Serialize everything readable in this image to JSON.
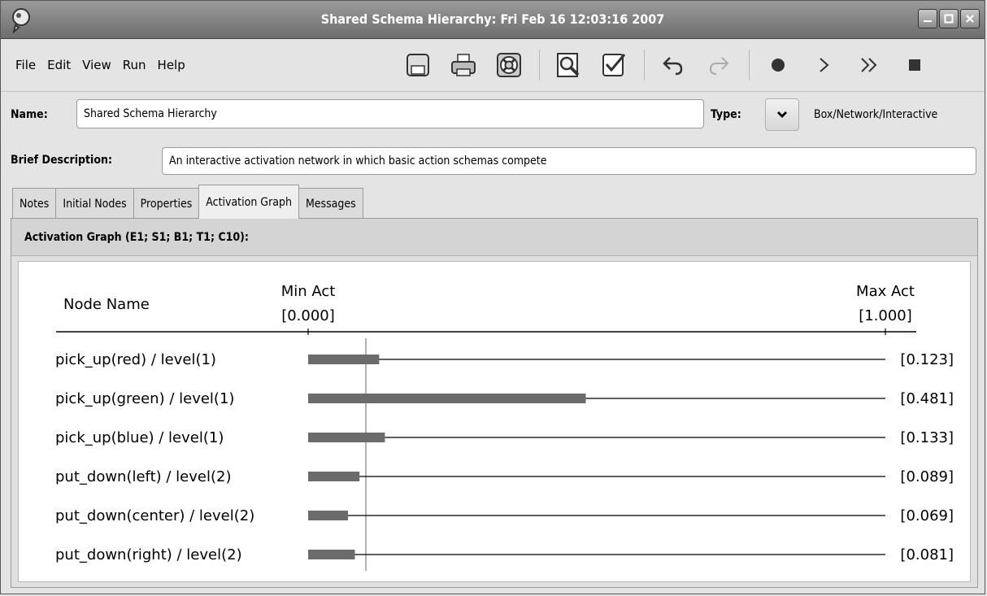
{
  "window": {
    "title": "Shared Schema Hierarchy: Fri Feb 16 12:03:16 2007",
    "controls": [
      "minimize",
      "maximize",
      "close"
    ]
  },
  "menu": {
    "items": [
      "File",
      "Edit",
      "View",
      "Run",
      "Help"
    ]
  },
  "toolbar": {
    "icons": [
      "save-icon",
      "print-icon",
      "lifebuoy-icon",
      "find-icon",
      "validate-icon",
      "undo-icon",
      "redo-icon",
      "record-icon",
      "step-icon",
      "fast-forward-icon",
      "stop-icon"
    ]
  },
  "form": {
    "name_label": "Name:",
    "name_value": "Shared Schema Hierarchy",
    "type_label": "Type:",
    "type_value": "Box/Network/Interactive",
    "desc_label": "Brief Description:",
    "desc_value": "An interactive activation network in which basic action schemas compete"
  },
  "tabs": [
    {
      "label": "Notes",
      "active": false
    },
    {
      "label": "Initial Nodes",
      "active": false
    },
    {
      "label": "Properties",
      "active": false
    },
    {
      "label": "Activation Graph",
      "active": true
    },
    {
      "label": "Messages",
      "active": false
    }
  ],
  "panel": {
    "header": "Activation Graph (E1; S1; B1; T1; C10):"
  },
  "chart_data": {
    "type": "bar",
    "column_header": "Node Name",
    "min_label": "Min Act",
    "min_value_label": "[0.000]",
    "max_label": "Max Act",
    "max_value_label": "[1.000]",
    "xlim": [
      0,
      1
    ],
    "marker_value": 0.1,
    "categories": [
      "pick_up(red) / level(1)",
      "pick_up(green) / level(1)",
      "pick_up(blue) / level(1)",
      "put_down(left) / level(2)",
      "put_down(center) / level(2)",
      "put_down(right) / level(2)"
    ],
    "values": [
      0.123,
      0.481,
      0.133,
      0.089,
      0.069,
      0.081
    ],
    "value_labels": [
      "[0.123]",
      "[0.481]",
      "[0.133]",
      "[0.089]",
      "[0.069]",
      "[0.081]"
    ],
    "bar_color": "#6b6b6b"
  }
}
